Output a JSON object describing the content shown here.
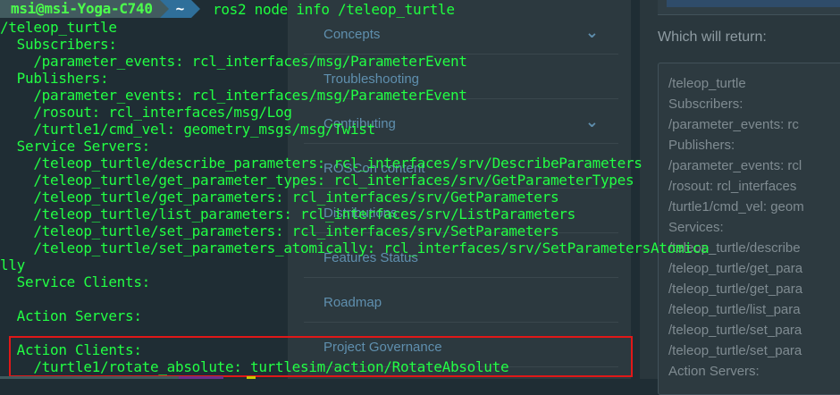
{
  "background_page": {
    "nav_items": [
      {
        "label": "Concepts",
        "has_chevron": true
      },
      {
        "label": "Troubleshooting",
        "has_chevron": false
      },
      {
        "label": "Contributing",
        "has_chevron": true
      },
      {
        "label": "ROSCon content",
        "has_chevron": false
      },
      {
        "label": "Distributions",
        "has_chevron": false
      },
      {
        "label": "Features Status",
        "has_chevron": false
      },
      {
        "label": "Roadmap",
        "has_chevron": false
      },
      {
        "label": "Project Governance",
        "has_chevron": false
      }
    ],
    "main_text": "Which will return:",
    "code_lines": [
      "/teleop_turtle",
      "  Subscribers:",
      "    /parameter_events: rc",
      "  Publishers:",
      "    /parameter_events: rcl",
      "    /rosout: rcl_interfaces",
      "    /turtle1/cmd_vel: geom",
      "  Services:",
      "    /teleop_turtle/describe",
      "    /teleop_turtle/get_para",
      "    /teleop_turtle/get_para",
      "    /teleop_turtle/list_para",
      "    /teleop_turtle/set_para",
      "    /teleop_turtle/set_para",
      "  Action Servers:"
    ]
  },
  "terminal": {
    "prompt_user": "msi@msi-Yoga-C740",
    "prompt_dir": "~",
    "command": "ros2 node info /teleop_turtle",
    "output_lines": [
      "/teleop_turtle",
      "  Subscribers:",
      "    /parameter_events: rcl_interfaces/msg/ParameterEvent",
      "  Publishers:",
      "    /parameter_events: rcl_interfaces/msg/ParameterEvent",
      "    /rosout: rcl_interfaces/msg/Log",
      "    /turtle1/cmd_vel: geometry_msgs/msg/Twist",
      "  Service Servers:",
      "    /teleop_turtle/describe_parameters: rcl_interfaces/srv/DescribeParameters",
      "    /teleop_turtle/get_parameter_types: rcl_interfaces/srv/GetParameterTypes",
      "    /teleop_turtle/get_parameters: rcl_interfaces/srv/GetParameters",
      "    /teleop_turtle/list_parameters: rcl_interfaces/srv/ListParameters",
      "    /teleop_turtle/set_parameters: rcl_interfaces/srv/SetParameters",
      "    /teleop_turtle/set_parameters_atomically: rcl_interfaces/srv/SetParametersAtomica",
      "lly",
      "  Service Clients:",
      "",
      "  Action Servers:",
      "",
      "  Action Clients:",
      "    /turtle1/rotate_absolute: turtlesim/action/RotateAbsolute"
    ]
  },
  "colors": {
    "terminal_text": "#22ff44",
    "highlight_border": "#e01818",
    "link": "#5f8fae"
  }
}
